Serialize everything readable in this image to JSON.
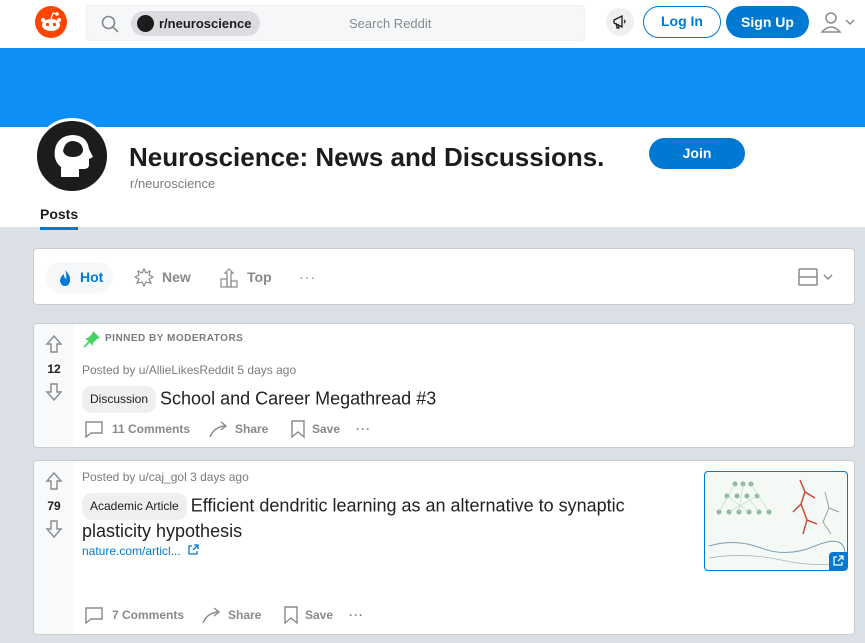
{
  "header": {
    "logo_icon": "reddit-alien-icon",
    "search": {
      "chip_label": "r/neuroscience",
      "placeholder": "Search Reddit"
    },
    "advertise_icon": "megaphone-icon",
    "login_label": "Log In",
    "signup_label": "Sign Up",
    "user_menu_icon": "user-icon"
  },
  "colors": {
    "brand_orange": "#ff4500",
    "accent_blue": "#0079d3",
    "banner_blue": "#0e8ff5",
    "pinned_green": "#46d160"
  },
  "community": {
    "title": "Neuroscience: News and Discussions.",
    "name": "r/neuroscience",
    "join_label": "Join",
    "tabs": [
      "Posts"
    ]
  },
  "sort": {
    "hot": "Hot",
    "new": "New",
    "top": "Top",
    "more": "···"
  },
  "posts": [
    {
      "pinned_label": "PINNED BY MODERATORS",
      "score": "12",
      "meta": "Posted by u/AllieLikesReddit 5 days ago",
      "flair": "Discussion",
      "title": "School and Career Megathread #3",
      "comments": "11 Comments",
      "share": "Share",
      "save": "Save",
      "more": "···"
    },
    {
      "score": "79",
      "meta": "Posted by u/caj_gol 3 days ago",
      "flair": "Academic Article",
      "title": "Efficient dendritic learning as an alternative to synaptic plasticity hypothesis",
      "link": "nature.com/articl...",
      "comments": "7 Comments",
      "share": "Share",
      "save": "Save",
      "more": "···"
    }
  ]
}
